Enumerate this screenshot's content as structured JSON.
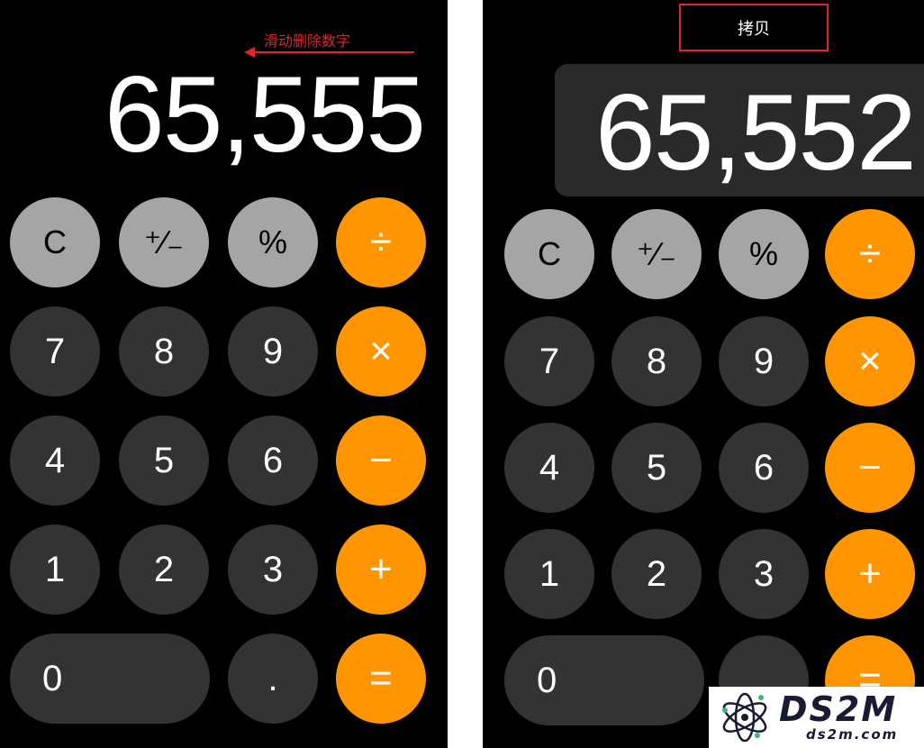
{
  "left": {
    "annotation": "滑动删除数字",
    "display": "65,555",
    "keys": {
      "clear": "C",
      "sign": "⁺∕₋",
      "percent": "%",
      "divide": "÷",
      "seven": "7",
      "eight": "8",
      "nine": "9",
      "multiply": "×",
      "four": "4",
      "five": "5",
      "six": "6",
      "minus": "−",
      "one": "1",
      "two": "2",
      "three": "3",
      "plus": "+",
      "zero": "0",
      "decimal": ".",
      "equals": "="
    }
  },
  "right": {
    "copy_popup": "拷贝",
    "display": "65,552",
    "keys": {
      "clear": "C",
      "sign": "⁺∕₋",
      "percent": "%",
      "divide": "÷",
      "seven": "7",
      "eight": "8",
      "nine": "9",
      "multiply": "×",
      "four": "4",
      "five": "5",
      "six": "6",
      "minus": "−",
      "one": "1",
      "two": "2",
      "three": "3",
      "plus": "+",
      "zero": "0",
      "equals": "="
    }
  },
  "watermark": {
    "brand": "DS2M",
    "domain": "ds2m.com",
    "icon": "atom-logo-icon"
  },
  "colors": {
    "function_key": "#a5a5a5",
    "number_key": "#333333",
    "operator_key": "#ff9500",
    "annotation_red": "#e0262b",
    "background": "#000000"
  }
}
